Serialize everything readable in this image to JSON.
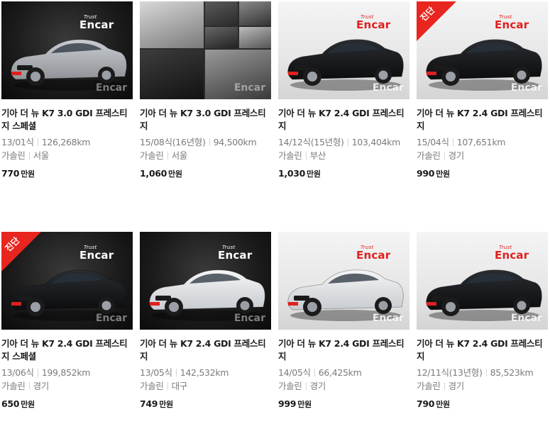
{
  "brand": {
    "logo_text": "Encar",
    "logo_sub": "Trust",
    "watermark": "Encar",
    "ribbon_label": "진단"
  },
  "cards": [
    {
      "title": "기아 더 뉴 K7 3.0 GDI 프레스티지 스페셜",
      "year": "13/01식",
      "mileage": "126,268km",
      "fuel": "가솔린",
      "region": "서울",
      "price": "770",
      "unit": "만원",
      "theme": "dark",
      "ribbon": false,
      "car_color": "silver"
    },
    {
      "title": "기아 더 뉴 K7 3.0 GDI 프레스티지",
      "year": "15/08식(16년형)",
      "mileage": "94,500km",
      "fuel": "가솔린",
      "region": "서울",
      "price": "1,060",
      "unit": "만원",
      "theme": "collage",
      "ribbon": false,
      "car_color": "black"
    },
    {
      "title": "기아 더 뉴 K7 2.4 GDI 프레스티지",
      "year": "14/12식(15년형)",
      "mileage": "103,404km",
      "fuel": "가솔린",
      "region": "부산",
      "price": "1,030",
      "unit": "만원",
      "theme": "light",
      "ribbon": false,
      "car_color": "black"
    },
    {
      "title": "기아 더 뉴 K7 2.4 GDI 프레스티지",
      "year": "15/04식",
      "mileage": "107,651km",
      "fuel": "가솔린",
      "region": "경기",
      "price": "990",
      "unit": "만원",
      "theme": "light",
      "ribbon": true,
      "car_color": "black"
    },
    {
      "title": "기아 더 뉴 K7 2.4 GDI 프레스티지 스페셜",
      "year": "13/06식",
      "mileage": "199,852km",
      "fuel": "가솔린",
      "region": "경기",
      "price": "650",
      "unit": "만원",
      "theme": "dark",
      "ribbon": true,
      "car_color": "black"
    },
    {
      "title": "기아 더 뉴 K7 2.4 GDI 프레스티지",
      "year": "13/05식",
      "mileage": "142,532km",
      "fuel": "가솔린",
      "region": "대구",
      "price": "749",
      "unit": "만원",
      "theme": "dark",
      "ribbon": false,
      "car_color": "white"
    },
    {
      "title": "기아 더 뉴 K7 2.4 GDI 프레스티지",
      "year": "14/05식",
      "mileage": "66,425km",
      "fuel": "가솔린",
      "region": "경기",
      "price": "999",
      "unit": "만원",
      "theme": "light",
      "ribbon": false,
      "car_color": "white"
    },
    {
      "title": "기아 더 뉴 K7 2.4 GDI 프레스티지",
      "year": "12/11식(13년형)",
      "mileage": "85,523km",
      "fuel": "가솔린",
      "region": "경기",
      "price": "790",
      "unit": "만원",
      "theme": "light",
      "ribbon": false,
      "car_color": "black"
    }
  ]
}
